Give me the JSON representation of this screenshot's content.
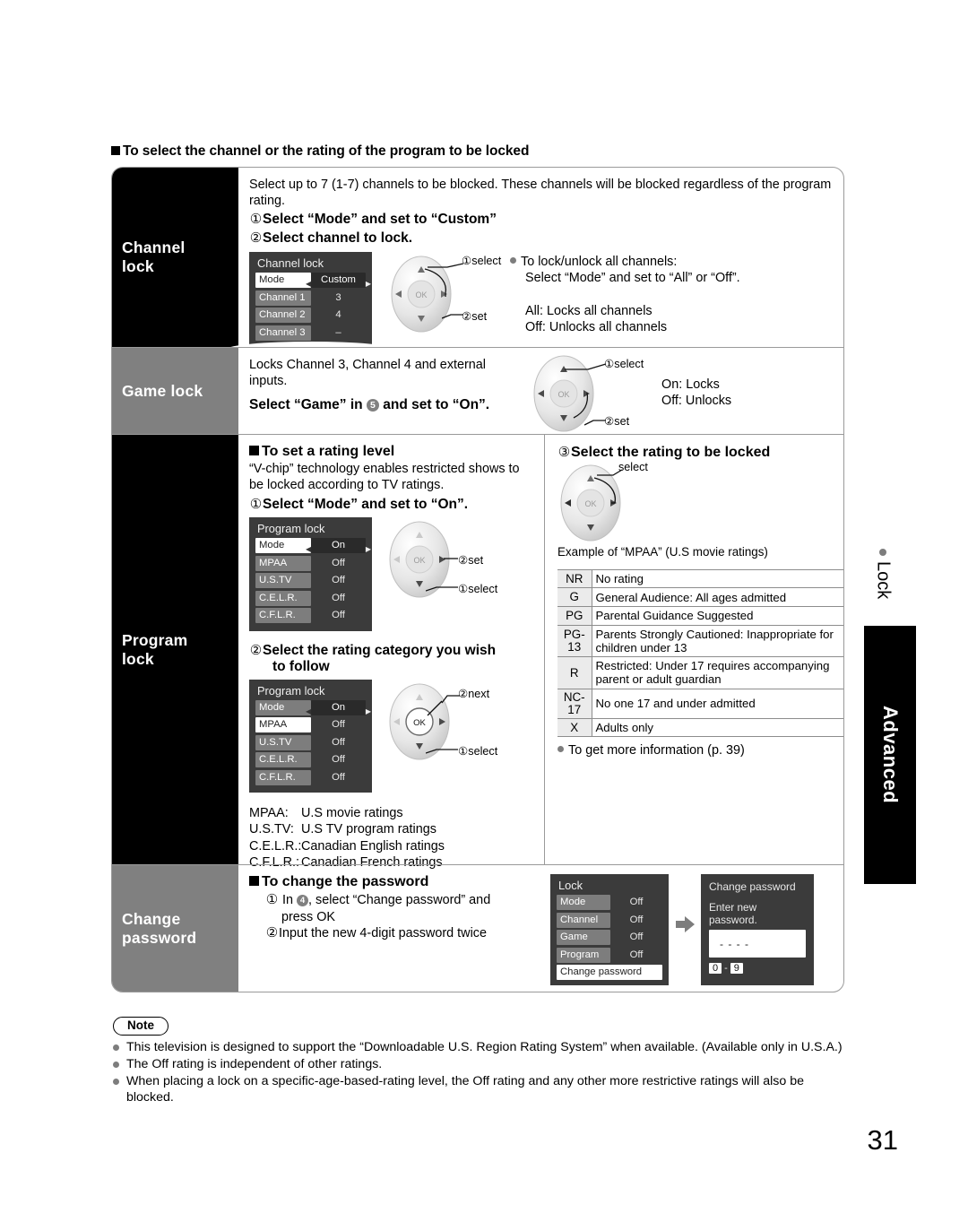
{
  "page": {
    "heading": "To select the channel or the rating of the program to be locked",
    "number": "31",
    "side_tab_lock": "Lock",
    "side_tab_advanced": "Advanced"
  },
  "categories": {
    "channel_lock": "Channel\nlock",
    "channel_lock_l1": "Channel",
    "channel_lock_l2": "lock",
    "game_lock": "Game lock",
    "program_lock_l1": "Program",
    "program_lock_l2": "lock",
    "change_password_l1": "Change",
    "change_password_l2": "password"
  },
  "channel_lock": {
    "intro": "Select up to 7 (1-7) channels to be blocked. These channels will be blocked regardless of the program rating.",
    "step1_num": "①",
    "step1": "Select “Mode” and set to “Custom”",
    "step2_num": "②",
    "step2": "Select channel to lock.",
    "osd": {
      "title": "Channel lock",
      "rows": [
        {
          "key": "Mode",
          "value": "Custom",
          "type": "mode"
        },
        {
          "key": "Channel 1",
          "value": "3",
          "type": "item"
        },
        {
          "key": "Channel 2",
          "value": "4",
          "type": "item"
        },
        {
          "key": "Channel 3",
          "value": "–",
          "type": "item"
        }
      ]
    },
    "dial_label_1": "①select",
    "dial_label_2": "②set",
    "notes": [
      "To lock/unlock all channels:",
      "Select “Mode” and set to “All” or “Off”.",
      "All:  Locks all channels",
      "Off: Unlocks all channels"
    ]
  },
  "game_lock": {
    "intro": "Locks Channel 3, Channel 4 and external inputs.",
    "bold_pre": "Select “Game” in",
    "bold_marker": "5",
    "bold_post": "and set to “On”.",
    "dial_label_1": "①select",
    "dial_label_2": "②set",
    "notes": [
      "On:  Locks",
      "Off:  Unlocks"
    ]
  },
  "program_lock": {
    "sub_heading": "To set a rating level",
    "intro": "“V-chip” technology enables restricted shows to be locked according to TV ratings.",
    "step1_num": "①",
    "step1": "Select “Mode” and set to “On”.",
    "osd1": {
      "title": "Program lock",
      "rows": [
        {
          "key": "Mode",
          "value": "On",
          "type": "mode"
        },
        {
          "key": "MPAA",
          "value": "Off",
          "type": "item"
        },
        {
          "key": "U.S.TV",
          "value": "Off",
          "type": "item"
        },
        {
          "key": "C.E.L.R.",
          "value": "Off",
          "type": "item"
        },
        {
          "key": "C.F.L.R.",
          "value": "Off",
          "type": "item"
        }
      ]
    },
    "dial1_label_1": "②set",
    "dial1_label_2": "①select",
    "step2_num": "②",
    "step2_l1": "Select the rating category you wish",
    "step2_l2": "to follow",
    "osd2": {
      "title": "Program lock",
      "rows": [
        {
          "key": "Mode",
          "value": "On",
          "type": "mode-unsel"
        },
        {
          "key": "MPAA",
          "value": "Off",
          "type": "item-sel"
        },
        {
          "key": "U.S.TV",
          "value": "Off",
          "type": "item"
        },
        {
          "key": "C.E.L.R.",
          "value": "Off",
          "type": "item"
        },
        {
          "key": "C.F.L.R.",
          "value": "Off",
          "type": "item"
        }
      ]
    },
    "dial2_label_1": "②next",
    "dial2_label_2": "①select",
    "glossary": [
      {
        "abbr": "MPAA:",
        "desc": "U.S movie ratings"
      },
      {
        "abbr": "U.S.TV:",
        "desc": "U.S TV program ratings"
      },
      {
        "abbr": "C.E.L.R.:",
        "desc": "Canadian English ratings"
      },
      {
        "abbr": "C.F.L.R.:",
        "desc": "Canadian French ratings"
      }
    ],
    "step3_num": "③",
    "step3": "Select the rating to be locked",
    "dial3_label": "select",
    "example_caption": "Example of “MPAA” (U.S movie ratings)",
    "ratings": [
      {
        "code": "NR",
        "desc": "No rating"
      },
      {
        "code": "G",
        "desc": "General Audience:  All ages admitted"
      },
      {
        "code": "PG",
        "desc": "Parental Guidance Suggested"
      },
      {
        "code": "PG-13",
        "desc": "Parents Strongly Cautioned:  Inappropriate for children under 13"
      },
      {
        "code": "R",
        "desc": "Restricted:  Under 17 requires accompanying parent or adult guardian"
      },
      {
        "code": "NC-17",
        "desc": "No one 17 and under admitted"
      },
      {
        "code": "X",
        "desc": "Adults only"
      }
    ],
    "more_info": "To get more information (p. 39)"
  },
  "change_password": {
    "sub_heading": "To change the password",
    "step1_num": "①",
    "step1_pre": "In",
    "step1_marker": "4",
    "step1_post": ", select “Change password” and",
    "step1_l2": "press OK",
    "step2_num": "②",
    "step2": "Input the new 4-digit password twice",
    "osd_lock": {
      "title": "Lock",
      "rows": [
        {
          "key": "Mode",
          "value": "Off"
        },
        {
          "key": "Channel",
          "value": "Off"
        },
        {
          "key": "Game",
          "value": "Off"
        },
        {
          "key": "Program",
          "value": "Off"
        }
      ],
      "selected_row": "Change password"
    },
    "osd_pw": {
      "title": "Change password",
      "prompt": "Enter new password.",
      "field_value": "- - - -",
      "key_lo": "0",
      "key_sep": "-",
      "key_hi": "9"
    }
  },
  "note": {
    "badge": "Note",
    "items": [
      "This television is designed to support the  “Downloadable U.S. Region Rating System” when available.  (Available only in U.S.A.)",
      "The Off rating is independent of other ratings.",
      "When placing a lock on a specific-age-based-rating level, the Off rating and any other more restrictive ratings will also be blocked."
    ]
  },
  "colors": {
    "cat_black": "#000000",
    "cat_gray": "#808080",
    "osd_bg": "#3b3b3b",
    "osd_key": "#7d7d7d",
    "frame_border": "#9a9a9a"
  }
}
